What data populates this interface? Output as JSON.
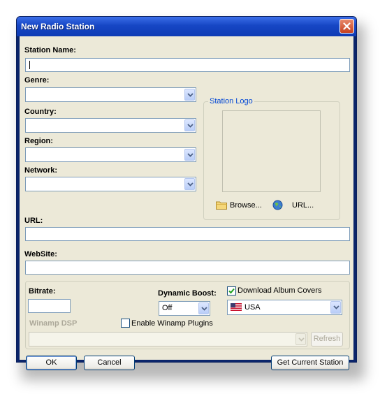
{
  "window": {
    "title": "New Radio Station"
  },
  "form": {
    "station_name_label": "Station Name:",
    "genre_label": "Genre:",
    "country_label": "Country:",
    "region_label": "Region:",
    "network_label": "Network:",
    "url_label": "URL:",
    "website_label": "WebSite:"
  },
  "logo": {
    "group_title": "Station Logo",
    "browse_label": "Browse...",
    "url_label": "URL..."
  },
  "options": {
    "bitrate_label": "Bitrate:",
    "dynamic_boost_label": "Dynamic Boost:",
    "dynamic_boost_value": "Off",
    "download_covers_label": "Download Album Covers",
    "download_covers_checked": true,
    "country_value": "USA",
    "winamp_dsp_label": "Winamp DSP",
    "enable_plugins_label": "Enable Winamp Plugins",
    "enable_plugins_checked": false,
    "refresh_label": "Refresh"
  },
  "buttons": {
    "ok": "OK",
    "cancel": "Cancel",
    "get_current": "Get Current Station"
  },
  "icons": {
    "close": "close-icon",
    "folder": "folder-icon",
    "globe": "globe-icon",
    "dropdown": "chevron-down-icon",
    "flag": "usa-flag-icon",
    "check": "checkmark-icon"
  },
  "colors": {
    "titlebar": "#1646c4",
    "dialog_bg": "#ece9d8",
    "group_title": "#0046d5",
    "field_border": "#7f9db9"
  }
}
